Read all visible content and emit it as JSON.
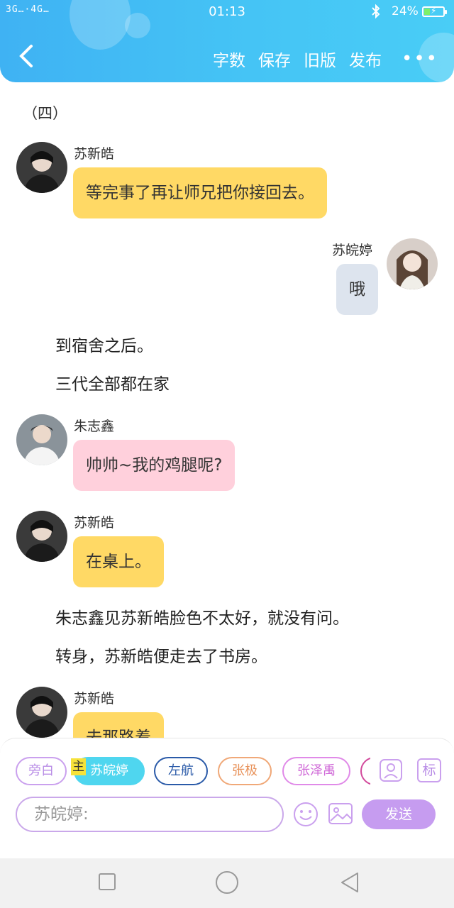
{
  "status_bar": {
    "signal": "3G…·4G…",
    "time": "01:13",
    "bluetooth": "bluetooth-icon",
    "battery_percent": "24%",
    "battery_level": 0.24
  },
  "header": {
    "back_icon": "chevron-left-icon",
    "actions": [
      "字数",
      "保存",
      "旧版",
      "发布"
    ],
    "more_label": "•••"
  },
  "content": {
    "chapter_title": "（四）",
    "messages": [
      {
        "speaker": "苏新皓",
        "text": "等完事了再让师兄把你接回去。"
      },
      {
        "speaker": "苏皖婷",
        "text": "哦"
      },
      {
        "speaker": "朱志鑫",
        "text": "帅帅~我的鸡腿呢?"
      },
      {
        "speaker": "苏新皓",
        "text": "在桌上。"
      },
      {
        "speaker": "苏新皓",
        "text": "去那路着"
      }
    ],
    "narrations": [
      "到宿舍之后。",
      "三代全部都在家",
      "朱志鑫见苏新皓脸色不太好，就没有问。",
      "转身，苏新皓便走去了书房。"
    ]
  },
  "composer": {
    "chips": [
      {
        "label": "旁白",
        "color": "#caa0ee"
      },
      {
        "label": "苏皖婷",
        "color": "#4fd6ef"
      },
      {
        "label": "左航",
        "color": "#2a5aa8"
      },
      {
        "label": "张极",
        "color": "#f0a878"
      },
      {
        "label": "张泽禹",
        "color": "#e08ae8"
      }
    ],
    "lead_badge": "主",
    "role_icon": "person-card-icon",
    "tag_label": "标",
    "input_placeholder": "苏皖婷:",
    "emoji_icon": "smiley-icon",
    "image_icon": "image-icon",
    "send_label": "发送"
  },
  "system_nav": {
    "recent": "square-icon",
    "home": "circle-icon",
    "back": "triangle-back-icon"
  },
  "colors": {
    "header": "#45c4f5",
    "bubble_yellow": "#ffd965",
    "bubble_pink": "#ffd0dc",
    "bubble_grey": "#dde4ee",
    "send": "#c69cf0"
  }
}
